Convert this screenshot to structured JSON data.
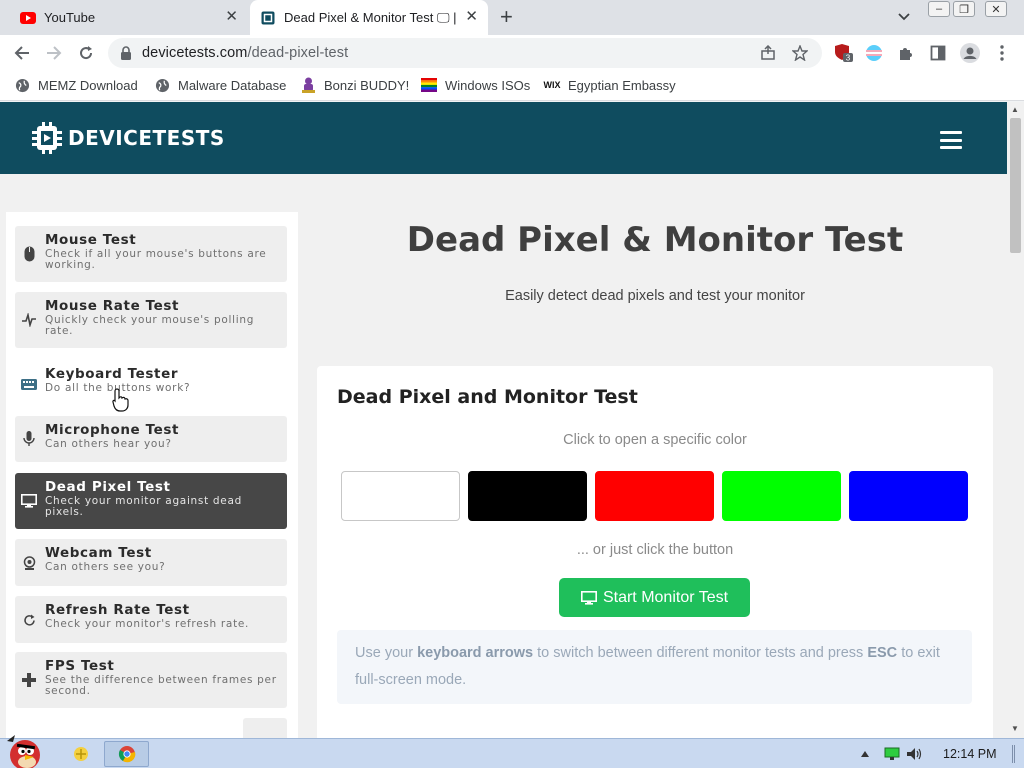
{
  "tabs": [
    {
      "title": "YouTube",
      "icon": "youtube-icon"
    },
    {
      "title": "Dead Pixel & Monitor Test 🖵 |",
      "icon": "devicetests-favicon"
    }
  ],
  "toolbar": {
    "url_host": "devicetests.com",
    "url_path": "/dead-pixel-test",
    "extension_badge": "3"
  },
  "bookmarks": [
    {
      "label": "MEMZ Download",
      "icon": "globe-icon"
    },
    {
      "label": "Malware Database",
      "icon": "globe-icon"
    },
    {
      "label": "Bonzi BUDDY!",
      "icon": "bonzi-icon"
    },
    {
      "label": "Windows ISOs",
      "icon": "rainbow-flag-icon"
    },
    {
      "label": "Egyptian Embassy",
      "icon": "wix-icon"
    }
  ],
  "site": {
    "logo_text": "DEVICETESTS"
  },
  "sidebar": {
    "items": [
      {
        "title": "Mouse Test",
        "desc": "Check if all your mouse's buttons are working.",
        "icon": "mouse-icon"
      },
      {
        "title": "Mouse Rate Test",
        "desc": "Quickly check your mouse's polling rate.",
        "icon": "pulse-icon"
      },
      {
        "title": "Keyboard Tester",
        "desc": "Do all the buttons work?",
        "icon": "keyboard-icon"
      },
      {
        "title": "Microphone Test",
        "desc": "Can others hear you?",
        "icon": "microphone-icon"
      },
      {
        "title": "Dead Pixel Test",
        "desc": "Check your monitor against dead pixels.",
        "icon": "monitor-icon"
      },
      {
        "title": "Webcam Test",
        "desc": "Can others see you?",
        "icon": "webcam-icon"
      },
      {
        "title": "Refresh Rate Test",
        "desc": "Check your monitor's refresh rate.",
        "icon": "refresh-icon"
      },
      {
        "title": "FPS Test",
        "desc": "See the difference between frames per second.",
        "icon": "gamepad-icon"
      }
    ]
  },
  "main": {
    "title": "Dead Pixel & Monitor Test",
    "subtitle": "Easily detect dead pixels and test your monitor",
    "card_title": "Dead Pixel and Monitor Test",
    "color_hint": "Click to open a specific color",
    "swatches": [
      "#ffffff",
      "#000000",
      "#ff0000",
      "#00ff00",
      "#0000ff"
    ],
    "or_text": "... or just click the button",
    "start_button": "Start Monitor Test",
    "note_prefix": "Use your ",
    "note_bold1": "keyboard arrows",
    "note_mid": " to switch between different monitor tests and press ",
    "note_bold2": "ESC",
    "note_suffix": " to exit full-screen mode."
  },
  "colors": {
    "header_bg": "#0f4c5f",
    "active_item_bg": "#474747",
    "start_button_bg": "#1fbf5b"
  },
  "taskbar": {
    "clock": "12:14 PM"
  }
}
